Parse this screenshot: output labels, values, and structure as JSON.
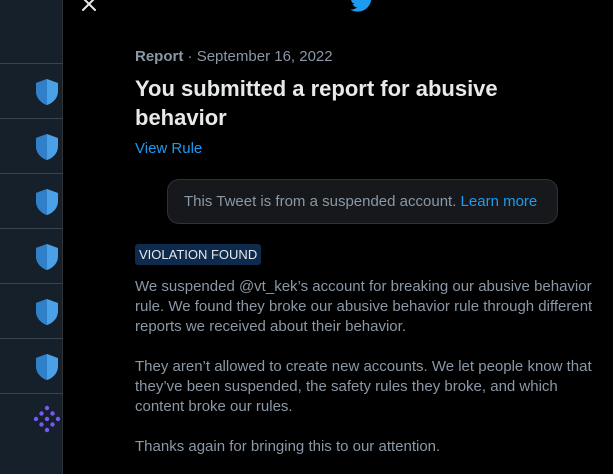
{
  "sidebar": {
    "items": [
      {
        "icon": "shield-icon"
      },
      {
        "icon": "shield-icon"
      },
      {
        "icon": "shield-icon"
      },
      {
        "icon": "shield-icon"
      },
      {
        "icon": "shield-icon"
      },
      {
        "icon": "shield-icon"
      }
    ],
    "bottom_icon": "dots-grid-icon"
  },
  "colors": {
    "accent": "#1d9bf0",
    "shield": "#4ba1e8",
    "dots": "#7856ff",
    "badge_bg": "#0e2a4d"
  },
  "report": {
    "kind": "Report",
    "separator": " · ",
    "date": "September 16, 2022",
    "title": "You submitted a report for abusive behavior",
    "rule_link": "View Rule",
    "tweet_notice": "This Tweet is from a suspended account.",
    "learn_more": "Learn more",
    "badge": "VIOLATION FOUND",
    "paragraphs": [
      "We suspended @vt_kek’s account for breaking our abusive behavior rule. We found they broke our abusive behavior rule through different reports we received about their behavior.",
      "They aren’t allowed to create new accounts. We let people know that they’ve been suspended, the safety rules they broke, and which content broke our rules.",
      "Thanks again for bringing this to our attention."
    ]
  }
}
